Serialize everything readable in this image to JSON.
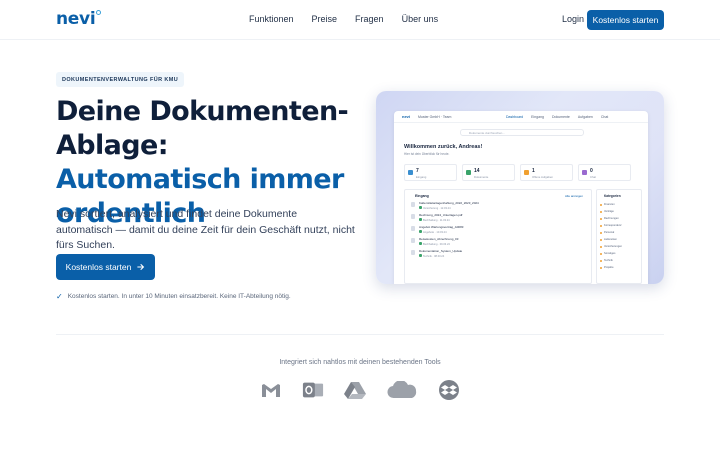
{
  "nav": {
    "logo": "nevi",
    "links": [
      "Funktionen",
      "Preise",
      "Fragen",
      "Über uns"
    ],
    "login": "Login",
    "cta": "Kostenlos starten"
  },
  "hero": {
    "badge": "DOKUMENTENVERWALTUNG FÜR KMU",
    "headline_line1": "Deine Dokumenten-",
    "headline_line2_plain": "Ablage: ",
    "headline_accent": "Automatisch immer ordentlich",
    "subline": "Nevi sortiert, analysiert und findet deine Dokumente automatisch — damit du deine Zeit für dein Geschäft nutzt, nicht fürs Suchen.",
    "cta": "Kostenlos starten",
    "note": "Kostenlos starten. In unter 10 Minuten einsatzbereit. Keine IT-Abteilung nötig."
  },
  "preview": {
    "logo": "nevi",
    "workspace": "Muster GmbH · Team",
    "tabs": [
      {
        "label": "Dashboard",
        "active": true
      },
      {
        "label": "Eingang",
        "active": false
      },
      {
        "label": "Dokumente",
        "active": false
      },
      {
        "label": "Aufgaben",
        "active": false
      },
      {
        "label": "Chat",
        "active": false
      }
    ],
    "search_placeholder": "Dokumente durchsuchen…",
    "welcome": "Willkommen zurück, Andreas!",
    "welcome_sub": "Hier ist dein Überblick für heute.",
    "stats": [
      {
        "value": "7",
        "label": "Eingang",
        "color": "#3a8fd0"
      },
      {
        "value": "14",
        "label": "Dokumente",
        "color": "#3aa36a"
      },
      {
        "value": "1",
        "label": "Offene Aufgaben",
        "color": "#f0a030"
      },
      {
        "value": "0",
        "label": "Chat",
        "color": "#9a6ad0"
      }
    ],
    "panel_title": "Eingang",
    "panel_link": "Alle anzeigen",
    "files": [
      {
        "name": "Kaltemittelanlagenhaftung_2022_2023_2024",
        "meta": "Versicherung · 12.03.24"
      },
      {
        "name": "Rechnung_2024_Unterlagen.pdf",
        "meta": "Buchhaltung · 11.03.24"
      },
      {
        "name": "Angebot Wartungsvertrag_A0083",
        "meta": "Angebote · 10.03.24"
      },
      {
        "name": "Reisekosten_Abrechnung_03",
        "meta": "Buchhaltung · 09.03.24"
      },
      {
        "name": "Dokumentation_System_Update",
        "meta": "Technik · 08.03.24"
      }
    ],
    "side_title": "Kategorien",
    "side_items": [
      "Finanzen",
      "Verträge",
      "Rechnungen",
      "Korrespondenz",
      "Personal",
      "Lieferanten",
      "Versicherungen",
      "Sonstiges",
      "Technik",
      "Projekte"
    ]
  },
  "integrations": {
    "title": "Integriert sich nahtlos mit deinen bestehenden Tools",
    "icons": [
      "gmail-icon",
      "outlook-icon",
      "google-drive-icon",
      "onedrive-icon",
      "dropbox-icon"
    ]
  }
}
